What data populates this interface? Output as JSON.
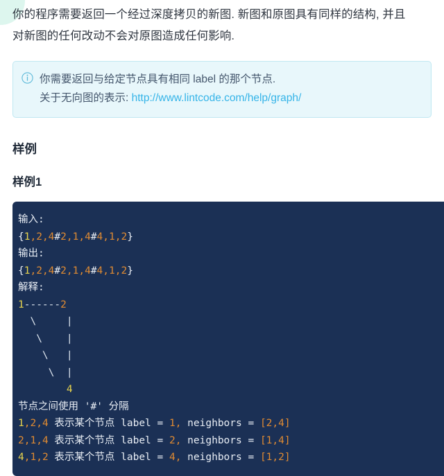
{
  "intro": {
    "lines": [
      "你的程序需要返回一个经过深度拷贝的新图. 新图和原图具有同样的结构, 并且",
      "对新图的任何改动不会对原图造成任何影响."
    ]
  },
  "note": {
    "icon": "info-circle-icon",
    "line1": "你需要返回与给定节点具有相同 label 的那个节点.",
    "line2_prefix": "关于无向图的表示: ",
    "link_text": "http://www.lintcode.com/help/graph/",
    "link_color": "#35b4e8",
    "background": "#e8f7fb",
    "border_color": "#bfe7f2"
  },
  "headings": {
    "section": "样例",
    "example": "样例1"
  },
  "code": {
    "background": "#1b3055",
    "colors": {
      "text": "#e9eef5",
      "yellow": "#e8d44d",
      "orange": "#e08b32"
    },
    "lines": [
      {
        "label": "输入:"
      },
      {
        "value": "{1,2,4#2,1,4#4,1,2}"
      },
      {
        "label": "输出:"
      },
      {
        "value": "{1,2,4#2,1,4#4,1,2}"
      },
      {
        "label": "解释:"
      }
    ],
    "ascii_art": [
      "1------2",
      "  \\     |",
      "   \\    |",
      "    \\   |",
      "     \\  |",
      "        4"
    ],
    "separator_note": "节点之间使用 '#' 分隔",
    "node_rows": [
      {
        "triple": "1,2,4",
        "desc": "表示某个节点",
        "label_key": "label",
        "label_value": "1",
        "neighbors_key": "neighbors",
        "neighbors_value": "[2,4]"
      },
      {
        "triple": "2,1,4",
        "desc": "表示某个节点",
        "label_key": "label",
        "label_value": "2",
        "neighbors_key": "neighbors",
        "neighbors_value": "[1,4]"
      },
      {
        "triple": "4,1,2",
        "desc": "表示某个节点",
        "label_key": "label",
        "label_value": "4",
        "neighbors_key": "neighbors",
        "neighbors_value": "[1,2]"
      }
    ]
  }
}
